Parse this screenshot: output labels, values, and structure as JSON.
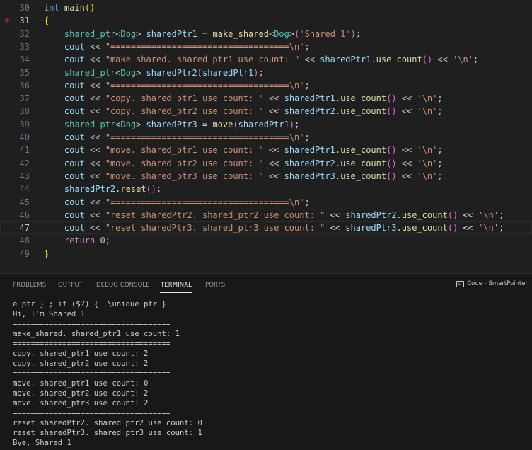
{
  "editor": {
    "lines": [
      {
        "n": "30",
        "segs": [
          [
            "kw",
            "int"
          ],
          [
            "txt",
            " "
          ],
          [
            "fn",
            "main"
          ],
          [
            "br1",
            "()"
          ]
        ]
      },
      {
        "n": "31",
        "segs": [
          [
            "br1",
            "{"
          ]
        ],
        "breakpoint": true,
        "active_number": true
      },
      {
        "n": "32",
        "segs": [
          [
            "txt",
            "    "
          ],
          [
            "ty",
            "shared_ptr"
          ],
          [
            "txt",
            "<"
          ],
          [
            "ty",
            "Dog"
          ],
          [
            "txt",
            "> "
          ],
          [
            "var",
            "sharedPtr1"
          ],
          [
            "txt",
            " = "
          ],
          [
            "fn",
            "make_shared"
          ],
          [
            "txt",
            "<"
          ],
          [
            "ty",
            "Dog"
          ],
          [
            "txt",
            ">"
          ],
          [
            "br2",
            "("
          ],
          [
            "str",
            "\"Shared 1\""
          ],
          [
            "br2",
            ")"
          ],
          [
            "txt",
            ";"
          ]
        ]
      },
      {
        "n": "33",
        "segs": [
          [
            "txt",
            "    "
          ],
          [
            "var",
            "cout"
          ],
          [
            "txt",
            " << "
          ],
          [
            "str",
            "\"===================================\\n\""
          ],
          [
            "txt",
            ";"
          ]
        ]
      },
      {
        "n": "34",
        "segs": [
          [
            "txt",
            "    "
          ],
          [
            "var",
            "cout"
          ],
          [
            "txt",
            " << "
          ],
          [
            "str",
            "\"make_shared. shared_ptr1 use count: \""
          ],
          [
            "txt",
            " << "
          ],
          [
            "var",
            "sharedPtr1"
          ],
          [
            "txt",
            "."
          ],
          [
            "fn",
            "use_count"
          ],
          [
            "br2",
            "()"
          ],
          [
            "txt",
            " << "
          ],
          [
            "str",
            "'\\n'"
          ],
          [
            "txt",
            ";"
          ]
        ]
      },
      {
        "n": "35",
        "segs": [
          [
            "txt",
            "    "
          ],
          [
            "ty",
            "shared_ptr"
          ],
          [
            "txt",
            "<"
          ],
          [
            "ty",
            "Dog"
          ],
          [
            "txt",
            "> "
          ],
          [
            "var",
            "sharedPtr2"
          ],
          [
            "br2",
            "("
          ],
          [
            "var",
            "sharedPtr1"
          ],
          [
            "br2",
            ")"
          ],
          [
            "txt",
            ";"
          ]
        ]
      },
      {
        "n": "36",
        "segs": [
          [
            "txt",
            "    "
          ],
          [
            "var",
            "cout"
          ],
          [
            "txt",
            " << "
          ],
          [
            "str",
            "\"===================================\\n\""
          ],
          [
            "txt",
            ";"
          ]
        ]
      },
      {
        "n": "37",
        "segs": [
          [
            "txt",
            "    "
          ],
          [
            "var",
            "cout"
          ],
          [
            "txt",
            " << "
          ],
          [
            "str",
            "\"copy. shared_ptr1 use count: \""
          ],
          [
            "txt",
            " << "
          ],
          [
            "var",
            "sharedPtr1"
          ],
          [
            "txt",
            "."
          ],
          [
            "fn",
            "use_count"
          ],
          [
            "br2",
            "()"
          ],
          [
            "txt",
            " << "
          ],
          [
            "str",
            "'\\n'"
          ],
          [
            "txt",
            ";"
          ]
        ]
      },
      {
        "n": "38",
        "segs": [
          [
            "txt",
            "    "
          ],
          [
            "var",
            "cout"
          ],
          [
            "txt",
            " << "
          ],
          [
            "str",
            "\"copy. shared_ptr2 use count: \""
          ],
          [
            "txt",
            " << "
          ],
          [
            "var",
            "sharedPtr2"
          ],
          [
            "txt",
            "."
          ],
          [
            "fn",
            "use_count"
          ],
          [
            "br2",
            "()"
          ],
          [
            "txt",
            " << "
          ],
          [
            "str",
            "'\\n'"
          ],
          [
            "txt",
            ";"
          ]
        ]
      },
      {
        "n": "39",
        "segs": [
          [
            "txt",
            "    "
          ],
          [
            "ty",
            "shared_ptr"
          ],
          [
            "txt",
            "<"
          ],
          [
            "ty",
            "Dog"
          ],
          [
            "txt",
            "> "
          ],
          [
            "var",
            "sharedPtr3"
          ],
          [
            "txt",
            " = "
          ],
          [
            "fn",
            "move"
          ],
          [
            "br2",
            "("
          ],
          [
            "var",
            "sharedPtr1"
          ],
          [
            "br2",
            ")"
          ],
          [
            "txt",
            ";"
          ]
        ]
      },
      {
        "n": "40",
        "segs": [
          [
            "txt",
            "    "
          ],
          [
            "var",
            "cout"
          ],
          [
            "txt",
            " << "
          ],
          [
            "str",
            "\"===================================\\n\""
          ],
          [
            "txt",
            ";"
          ]
        ]
      },
      {
        "n": "41",
        "segs": [
          [
            "txt",
            "    "
          ],
          [
            "var",
            "cout"
          ],
          [
            "txt",
            " << "
          ],
          [
            "str",
            "\"move. shared_ptr1 use count: \""
          ],
          [
            "txt",
            " << "
          ],
          [
            "var",
            "sharedPtr1"
          ],
          [
            "txt",
            "."
          ],
          [
            "fn",
            "use_count"
          ],
          [
            "br2",
            "()"
          ],
          [
            "txt",
            " << "
          ],
          [
            "str",
            "'\\n'"
          ],
          [
            "txt",
            ";"
          ]
        ]
      },
      {
        "n": "42",
        "segs": [
          [
            "txt",
            "    "
          ],
          [
            "var",
            "cout"
          ],
          [
            "txt",
            " << "
          ],
          [
            "str",
            "\"move. shared_ptr2 use count: \""
          ],
          [
            "txt",
            " << "
          ],
          [
            "var",
            "sharedPtr2"
          ],
          [
            "txt",
            "."
          ],
          [
            "fn",
            "use_count"
          ],
          [
            "br2",
            "()"
          ],
          [
            "txt",
            " << "
          ],
          [
            "str",
            "'\\n'"
          ],
          [
            "txt",
            ";"
          ]
        ]
      },
      {
        "n": "43",
        "segs": [
          [
            "txt",
            "    "
          ],
          [
            "var",
            "cout"
          ],
          [
            "txt",
            " << "
          ],
          [
            "str",
            "\"move. shared_ptr3 use count: \""
          ],
          [
            "txt",
            " << "
          ],
          [
            "var",
            "sharedPtr3"
          ],
          [
            "txt",
            "."
          ],
          [
            "fn",
            "use_count"
          ],
          [
            "br2",
            "()"
          ],
          [
            "txt",
            " << "
          ],
          [
            "str",
            "'\\n'"
          ],
          [
            "txt",
            ";"
          ]
        ]
      },
      {
        "n": "44",
        "segs": [
          [
            "txt",
            "    "
          ],
          [
            "var",
            "sharedPtr2"
          ],
          [
            "txt",
            "."
          ],
          [
            "fn",
            "reset"
          ],
          [
            "br2",
            "()"
          ],
          [
            "txt",
            ";"
          ]
        ]
      },
      {
        "n": "45",
        "segs": [
          [
            "txt",
            "    "
          ],
          [
            "var",
            "cout"
          ],
          [
            "txt",
            " << "
          ],
          [
            "str",
            "\"===================================\\n\""
          ],
          [
            "txt",
            ";"
          ]
        ]
      },
      {
        "n": "46",
        "segs": [
          [
            "txt",
            "    "
          ],
          [
            "var",
            "cout"
          ],
          [
            "txt",
            " << "
          ],
          [
            "str",
            "\"reset sharedPtr2. shared_ptr2 use count: \""
          ],
          [
            "txt",
            " << "
          ],
          [
            "var",
            "sharedPtr2"
          ],
          [
            "txt",
            "."
          ],
          [
            "fn",
            "use_count"
          ],
          [
            "br2",
            "()"
          ],
          [
            "txt",
            " << "
          ],
          [
            "str",
            "'\\n'"
          ],
          [
            "txt",
            ";"
          ]
        ]
      },
      {
        "n": "47",
        "segs": [
          [
            "txt",
            "    "
          ],
          [
            "var",
            "cout"
          ],
          [
            "txt",
            " << "
          ],
          [
            "str",
            "\"reset sharedPtr3. shared_ptr3 use count: \""
          ],
          [
            "txt",
            " << "
          ],
          [
            "var",
            "sharedPtr3"
          ],
          [
            "txt",
            "."
          ],
          [
            "fn",
            "use_count"
          ],
          [
            "br2",
            "()"
          ],
          [
            "txt",
            " << "
          ],
          [
            "str",
            "'\\n'"
          ],
          [
            "txt",
            ";"
          ]
        ],
        "current": true,
        "active_number": true
      },
      {
        "n": "48",
        "segs": [
          [
            "txt",
            "    "
          ],
          [
            "kwc",
            "return"
          ],
          [
            "txt",
            " "
          ],
          [
            "num",
            "0"
          ],
          [
            "txt",
            ";"
          ]
        ]
      },
      {
        "n": "49",
        "segs": [
          [
            "br1",
            "}"
          ]
        ]
      }
    ]
  },
  "panel": {
    "tabs": [
      {
        "label": "PROBLEMS",
        "active": false
      },
      {
        "label": "OUTPUT",
        "active": false
      },
      {
        "label": "DEBUG CONSOLE",
        "active": false
      },
      {
        "label": "TERMINAL",
        "active": true
      },
      {
        "label": "PORTS",
        "active": false
      }
    ],
    "terminal_title": "Code - SmartPointer",
    "terminal_icon": "terminal-icon",
    "terminal_lines": [
      "e_ptr } ; if ($?) { .\\unique_ptr }",
      "Hi, I'm Shared 1",
      "===================================",
      "make_shared. shared_ptr1 use count: 1",
      "===================================",
      "copy. shared_ptr1 use count: 2",
      "copy. shared_ptr2 use count: 2",
      "===================================",
      "move. shared_ptr1 use count: 0",
      "move. shared_ptr2 use count: 2",
      "move. shared_ptr3 use count: 2",
      "===================================",
      "reset sharedPtr2. shared_ptr2 use count: 0",
      "reset sharedPtr3. shared_ptr3 use count: 1",
      "Bye, Shared 1"
    ]
  }
}
